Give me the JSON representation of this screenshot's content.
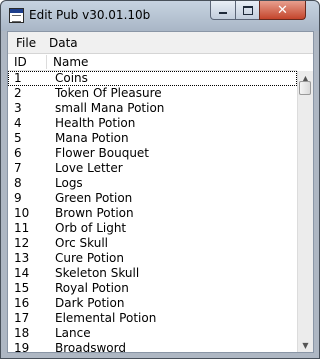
{
  "window": {
    "title": "Edit Pub v30.01.10b",
    "controls": {
      "minimize_icon": "minimize-icon",
      "maximize_icon": "maximize-icon",
      "close_glyph": "✕"
    }
  },
  "menu": {
    "items": [
      "File",
      "Data"
    ]
  },
  "list": {
    "columns": {
      "id": "ID",
      "name": "Name"
    },
    "selected_row_index": 0,
    "rows": [
      {
        "id": "1",
        "name": "Coins"
      },
      {
        "id": "2",
        "name": "Token Of Pleasure"
      },
      {
        "id": "3",
        "name": "small Mana Potion"
      },
      {
        "id": "4",
        "name": "Health Potion"
      },
      {
        "id": "5",
        "name": "Mana Potion"
      },
      {
        "id": "6",
        "name": "Flower Bouquet"
      },
      {
        "id": "7",
        "name": "Love Letter"
      },
      {
        "id": "8",
        "name": "Logs"
      },
      {
        "id": "9",
        "name": "Green Potion"
      },
      {
        "id": "10",
        "name": "Brown Potion"
      },
      {
        "id": "11",
        "name": "Orb of Light"
      },
      {
        "id": "12",
        "name": "Orc Skull"
      },
      {
        "id": "13",
        "name": "Cure Potion"
      },
      {
        "id": "14",
        "name": "Skeleton Skull"
      },
      {
        "id": "15",
        "name": "Royal Potion"
      },
      {
        "id": "16",
        "name": "Dark Potion"
      },
      {
        "id": "17",
        "name": "Elemental Potion"
      },
      {
        "id": "18",
        "name": "Lance"
      },
      {
        "id": "19",
        "name": "Broadsword"
      }
    ]
  },
  "scrollbar": {
    "up_arrow": "▲",
    "down_arrow": "▼",
    "position_fraction": 0.0
  }
}
